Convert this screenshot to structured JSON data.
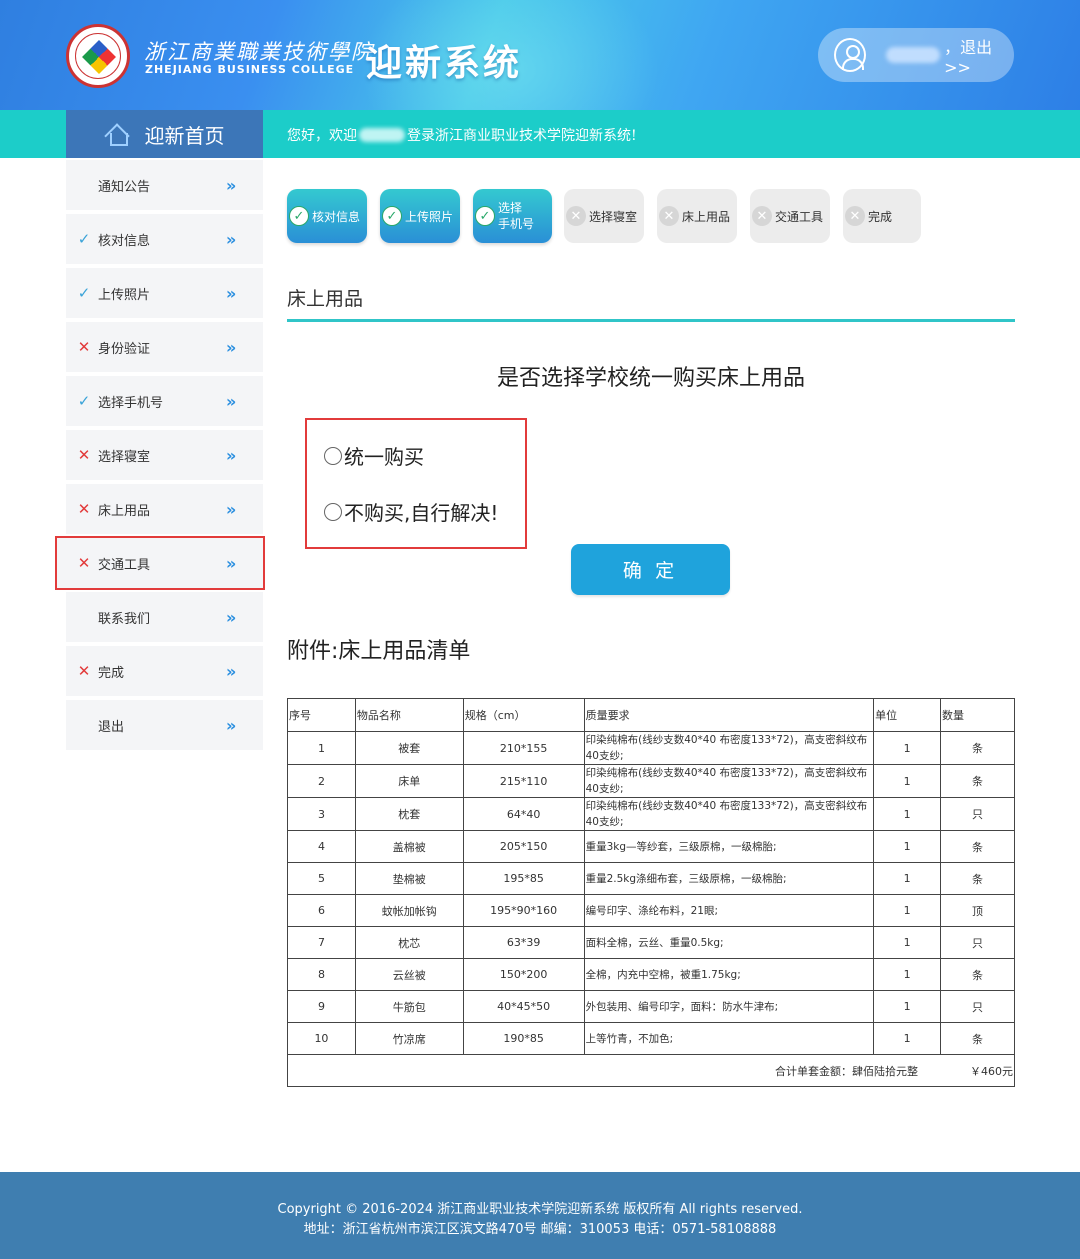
{
  "header": {
    "school_cn": "浙江商業職業技術學院",
    "school_en": "ZHEJIANG BUSINESS COLLEGE",
    "system_title": "迎新系统",
    "logout_label": "，退出>>",
    "user_icon": "user-circle-icon"
  },
  "topbar": {
    "home_label": "迎新首页",
    "home_icon": "home-icon",
    "welcome_prefix": "您好，欢迎",
    "welcome_suffix": "登录浙江商业职业技术学院迎新系统!"
  },
  "sidebar": {
    "items": [
      {
        "label": "通知公告",
        "status": "none"
      },
      {
        "label": "核对信息",
        "status": "done"
      },
      {
        "label": "上传照片",
        "status": "done"
      },
      {
        "label": "身份验证",
        "status": "fail"
      },
      {
        "label": "选择手机号",
        "status": "done"
      },
      {
        "label": "选择寝室",
        "status": "fail"
      },
      {
        "label": "床上用品",
        "status": "fail"
      },
      {
        "label": "交通工具",
        "status": "fail"
      },
      {
        "label": "联系我们",
        "status": "none"
      },
      {
        "label": "完成",
        "status": "fail"
      },
      {
        "label": "退出",
        "status": "none"
      }
    ],
    "chevron": "»",
    "done_mark": "✓",
    "fail_mark": "✕"
  },
  "steps": [
    {
      "label": "核对信息",
      "done": true
    },
    {
      "label": "上传照片",
      "done": true
    },
    {
      "label_line1": "选择",
      "label_line2": "手机号",
      "done": true
    },
    {
      "label": "选择寝室",
      "done": false
    },
    {
      "label": "床上用品",
      "done": false
    },
    {
      "label": "交通工具",
      "done": false
    },
    {
      "label": "完成",
      "done": false
    }
  ],
  "step_marks": {
    "done": "✓",
    "todo": "✕"
  },
  "main": {
    "section_title": "床上用品",
    "question": "是否选择学校统一购买床上用品",
    "options": [
      "统一购买",
      "不购买,自行解决!"
    ],
    "confirm_label": "确 定",
    "attachment_title": "附件:床上用品清单"
  },
  "table": {
    "headers": [
      "序号",
      "物品名称",
      "规格（cm）",
      "质量要求",
      "单位",
      "数量"
    ],
    "rows": [
      {
        "no": "1",
        "name": "被套",
        "spec": "210*155",
        "quality": "印染纯棉布(线纱支数40*40 布密度133*72)，高支密斜纹布40支纱;",
        "unit": "1",
        "qty": "条"
      },
      {
        "no": "2",
        "name": "床单",
        "spec": "215*110",
        "quality": "印染纯棉布(线纱支数40*40 布密度133*72)，高支密斜纹布40支纱;",
        "unit": "1",
        "qty": "条"
      },
      {
        "no": "3",
        "name": "枕套",
        "spec": "64*40",
        "quality": "印染纯棉布(线纱支数40*40 布密度133*72)，高支密斜纹布40支纱;",
        "unit": "1",
        "qty": "只"
      },
      {
        "no": "4",
        "name": "盖棉被",
        "spec": "205*150",
        "quality": "重量3kg—等纱套，三级原棉，一级棉胎;",
        "unit": "1",
        "qty": "条"
      },
      {
        "no": "5",
        "name": "垫棉被",
        "spec": "195*85",
        "quality": "重量2.5kg涤细布套，三级原棉，一级棉胎;",
        "unit": "1",
        "qty": "条"
      },
      {
        "no": "6",
        "name": "蚊帐加帐钩",
        "spec": "195*90*160",
        "quality": "编号印字、涤纶布料，21眼;",
        "unit": "1",
        "qty": "顶"
      },
      {
        "no": "7",
        "name": "枕芯",
        "spec": "63*39",
        "quality": "面料全棉，云丝、重量0.5kg;",
        "unit": "1",
        "qty": "只"
      },
      {
        "no": "8",
        "name": "云丝被",
        "spec": "150*200",
        "quality": "全棉，内充中空棉，被重1.75kg;",
        "unit": "1",
        "qty": "条"
      },
      {
        "no": "9",
        "name": "牛筋包",
        "spec": "40*45*50",
        "quality": "外包装用、编号印字，面料：防水牛津布;",
        "unit": "1",
        "qty": "只"
      },
      {
        "no": "10",
        "name": "竹凉席",
        "spec": "190*85",
        "quality": "上等竹青，不加色;",
        "unit": "1",
        "qty": "条"
      }
    ],
    "total_label": "合计单套金额：肆佰陆拾元整",
    "total_value": "￥460元"
  },
  "footer": {
    "copyright": "Copyright © 2016-2024 浙江商业职业技术学院迎新系统 版权所有 All rights reserved.",
    "address": "地址：浙江省杭州市滨江区滨文路470号 邮编：310053 电话：0571-58108888"
  },
  "colors": {
    "teal": "#1ccdc9",
    "home_tab": "#3c76b8",
    "accent_blue": "#1fa3dc",
    "error_red": "#e23b3b",
    "footer": "#3f7eb0"
  }
}
